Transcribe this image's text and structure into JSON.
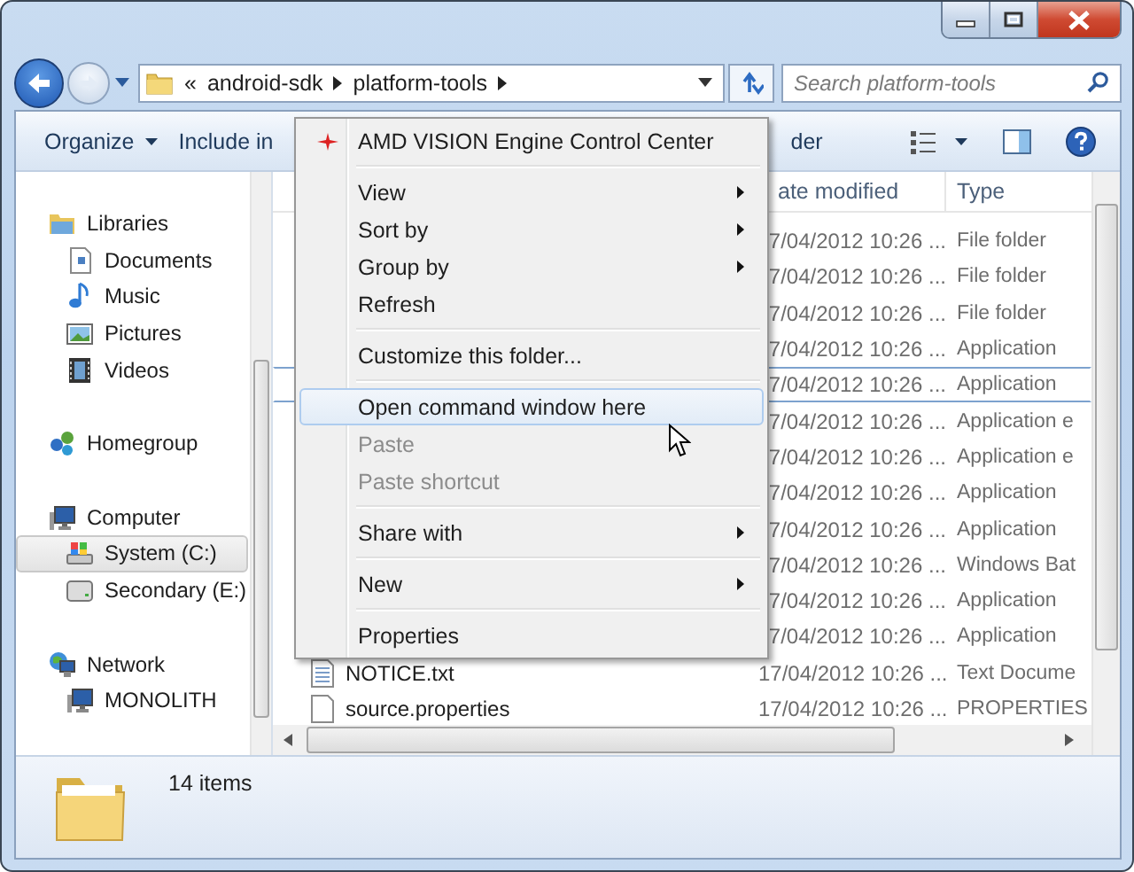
{
  "navigation": {
    "path": [
      {
        "label": "«"
      },
      {
        "label": "android-sdk"
      },
      {
        "label": "platform-tools"
      }
    ],
    "search": {
      "placeholder": "Search platform-tools"
    }
  },
  "toolbar": {
    "items": [
      {
        "label": "Organize",
        "dropdown": true
      },
      {
        "label": "Include in",
        "dropdown": false
      },
      {
        "label": "der",
        "dropdown": false
      }
    ]
  },
  "sidebar": {
    "groups": [
      {
        "label": "Libraries",
        "kind": "library",
        "selected": false,
        "children": [
          {
            "label": "Documents",
            "kind": "documents",
            "selected": false
          },
          {
            "label": "Music",
            "kind": "music",
            "selected": false
          },
          {
            "label": "Pictures",
            "kind": "pictures",
            "selected": false
          },
          {
            "label": "Videos",
            "kind": "videos",
            "selected": false
          }
        ]
      },
      {
        "label": "Homegroup",
        "kind": "homegroup",
        "selected": false
      },
      {
        "label": "Computer",
        "kind": "computer",
        "selected": false,
        "children": [
          {
            "label": "System (C:)",
            "kind": "system-drive",
            "selected": true
          },
          {
            "label": "Secondary (E:)",
            "kind": "drive",
            "selected": false
          }
        ]
      },
      {
        "label": "Network",
        "kind": "network",
        "selected": false,
        "children": [
          {
            "label": "MONOLITH",
            "kind": "computer",
            "selected": false
          }
        ]
      }
    ]
  },
  "file_list": {
    "columns": [
      {
        "label": "ate modified"
      },
      {
        "label": "Type"
      }
    ],
    "rows": [
      {
        "date": "7/04/2012 10:26 ...",
        "type": "File folder",
        "selected": false
      },
      {
        "date": "7/04/2012 10:26 ...",
        "type": "File folder",
        "selected": false
      },
      {
        "date": "7/04/2012 10:26 ...",
        "type": "File folder",
        "selected": false
      },
      {
        "date": "7/04/2012 10:26 ...",
        "type": "Application",
        "selected": false
      },
      {
        "date": "7/04/2012 10:26 ...",
        "type": "Application",
        "selected": true
      },
      {
        "date": "7/04/2012 10:26 ...",
        "type": "Application e",
        "selected": false
      },
      {
        "date": "7/04/2012 10:26 ...",
        "type": "Application e",
        "selected": false
      },
      {
        "date": "7/04/2012 10:26 ...",
        "type": "Application",
        "selected": false
      },
      {
        "date": "7/04/2012 10:26 ...",
        "type": "Application",
        "selected": false
      },
      {
        "date": "7/04/2012 10:26 ...",
        "type": "Windows Bat",
        "selected": false
      },
      {
        "date": "7/04/2012 10:26 ...",
        "type": "Application",
        "selected": false
      },
      {
        "date": "7/04/2012 10:26 ...",
        "type": "Application",
        "selected": false
      },
      {
        "name": "NOTICE.txt",
        "kind": "document",
        "date": "17/04/2012 10:26 ...",
        "type": "Text Docume",
        "selected": false
      },
      {
        "name": "source.properties",
        "kind": "plain",
        "date": "17/04/2012 10:26 ...",
        "type": "PROPERTIES",
        "selected": false
      }
    ]
  },
  "details_pane": {
    "count": "14 items"
  },
  "context_menu": {
    "items": [
      {
        "kind": "item",
        "label": "AMD VISION Engine Control Center",
        "icon": true,
        "submenu": false,
        "disabled": false,
        "highlighted": false
      },
      {
        "kind": "separator"
      },
      {
        "kind": "item",
        "label": "View",
        "icon": false,
        "submenu": true,
        "disabled": false,
        "highlighted": false
      },
      {
        "kind": "item",
        "label": "Sort by",
        "icon": false,
        "submenu": true,
        "disabled": false,
        "highlighted": false
      },
      {
        "kind": "item",
        "label": "Group by",
        "icon": false,
        "submenu": true,
        "disabled": false,
        "highlighted": false
      },
      {
        "kind": "item",
        "label": "Refresh",
        "icon": false,
        "submenu": false,
        "disabled": false,
        "highlighted": false
      },
      {
        "kind": "separator"
      },
      {
        "kind": "item",
        "label": "Customize this folder...",
        "icon": false,
        "submenu": false,
        "disabled": false,
        "highlighted": false
      },
      {
        "kind": "separator"
      },
      {
        "kind": "item",
        "label": "Open command window here",
        "icon": false,
        "submenu": false,
        "disabled": false,
        "highlighted": true
      },
      {
        "kind": "item",
        "label": "Paste",
        "icon": false,
        "submenu": false,
        "disabled": true,
        "highlighted": false
      },
      {
        "kind": "item",
        "label": "Paste shortcut",
        "icon": false,
        "submenu": false,
        "disabled": true,
        "highlighted": false
      },
      {
        "kind": "separator"
      },
      {
        "kind": "item",
        "label": "Share with",
        "icon": false,
        "submenu": true,
        "disabled": false,
        "highlighted": false
      },
      {
        "kind": "separator"
      },
      {
        "kind": "item",
        "label": "New",
        "icon": false,
        "submenu": true,
        "disabled": false,
        "highlighted": false
      },
      {
        "kind": "separator"
      },
      {
        "kind": "item",
        "label": "Properties",
        "icon": false,
        "submenu": false,
        "disabled": false,
        "highlighted": false
      }
    ]
  }
}
